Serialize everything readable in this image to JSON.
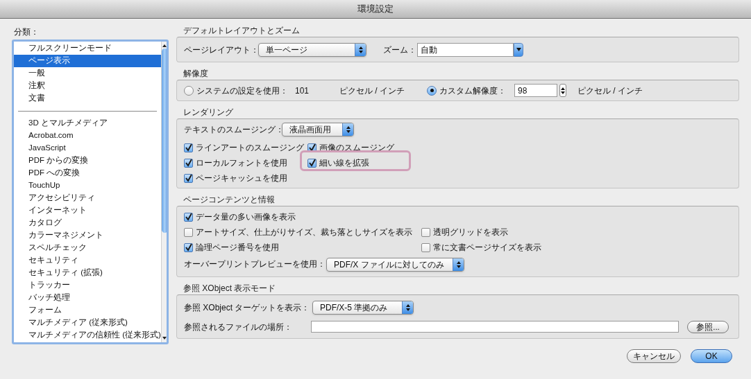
{
  "window": {
    "title": "環境設定"
  },
  "sidebar": {
    "label": "分類：",
    "groups": [
      {
        "items": [
          {
            "label": "フルスクリーンモード",
            "selected": false
          },
          {
            "label": "ページ表示",
            "selected": true
          },
          {
            "label": "一般",
            "selected": false
          },
          {
            "label": "注釈",
            "selected": false
          },
          {
            "label": "文書",
            "selected": false
          }
        ]
      },
      {
        "items": [
          {
            "label": "3D とマルチメディア",
            "selected": false
          },
          {
            "label": "Acrobat.com",
            "selected": false
          },
          {
            "label": "JavaScript",
            "selected": false
          },
          {
            "label": "PDF からの変換",
            "selected": false
          },
          {
            "label": "PDF への変換",
            "selected": false
          },
          {
            "label": "TouchUp",
            "selected": false
          },
          {
            "label": "アクセシビリティ",
            "selected": false
          },
          {
            "label": "インターネット",
            "selected": false
          },
          {
            "label": "カタログ",
            "selected": false
          },
          {
            "label": "カラーマネジメント",
            "selected": false
          },
          {
            "label": "スペルチェック",
            "selected": false
          },
          {
            "label": "セキュリティ",
            "selected": false
          },
          {
            "label": "セキュリティ (拡張)",
            "selected": false
          },
          {
            "label": "トラッカー",
            "selected": false
          },
          {
            "label": "バッチ処理",
            "selected": false
          },
          {
            "label": "フォーム",
            "selected": false
          },
          {
            "label": "マルチメディア (従来形式)",
            "selected": false
          },
          {
            "label": "マルチメディアの信頼性 (従来形式)",
            "selected": false
          }
        ]
      }
    ]
  },
  "layout_zoom": {
    "title": "デフォルトレイアウトとズーム",
    "page_layout": {
      "label": "ページレイアウト：",
      "value": "単一ページ",
      "kind": "popup"
    },
    "zoom": {
      "label": "ズーム：",
      "value": "自動",
      "kind": "combo"
    }
  },
  "resolution": {
    "title": "解像度",
    "options": [
      {
        "kind": "static",
        "label": "システムの設定を使用：",
        "value": "101",
        "unit": "ピクセル / インチ",
        "selected": false
      },
      {
        "kind": "input",
        "label": "カスタム解像度：",
        "value": "98",
        "unit": "ピクセル / インチ",
        "selected": true
      }
    ]
  },
  "rendering": {
    "title": "レンダリング",
    "text_smoothing": {
      "label": "テキストのスムージング：",
      "value": "液晶画面用",
      "kind": "popup"
    },
    "rows": [
      [
        {
          "label": "ラインアートのスムージング",
          "checked": true,
          "highlighted": false
        },
        {
          "label": "画像のスムージング",
          "checked": true,
          "highlighted": false
        }
      ],
      [
        {
          "label": "ローカルフォントを使用",
          "checked": true,
          "highlighted": false
        },
        {
          "label": "細い線を拡張",
          "checked": true,
          "highlighted": true
        }
      ],
      [
        {
          "label": "ページキャッシュを使用",
          "checked": true,
          "highlighted": false
        }
      ]
    ]
  },
  "page_content": {
    "title": "ページコンテンツと情報",
    "rows": [
      [
        {
          "label": "データ量の多い画像を表示",
          "checked": true
        }
      ],
      [
        {
          "label": "アートサイズ、仕上がりサイズ、裁ち落としサイズを表示",
          "checked": false
        },
        {
          "label": "透明グリッドを表示",
          "checked": false
        }
      ],
      [
        {
          "label": "論理ページ番号を使用",
          "checked": true
        },
        {
          "label": "常に文書ページサイズを表示",
          "checked": false
        }
      ]
    ],
    "overprint": {
      "label": "オーバープリントプレビューを使用：",
      "value": "PDF/X ファイルに対してのみ",
      "kind": "popup"
    }
  },
  "xobject": {
    "title": "参照 XObject 表示モード",
    "target": {
      "label": "参照 XObject ターゲットを表示：",
      "value": "PDF/X-5 準拠のみ",
      "kind": "popup"
    },
    "location": {
      "label": "参照されるファイルの場所：",
      "button": "参照..."
    }
  },
  "buttons": [
    {
      "label": "キャンセル",
      "default": false
    },
    {
      "label": "OK",
      "default": true
    }
  ]
}
